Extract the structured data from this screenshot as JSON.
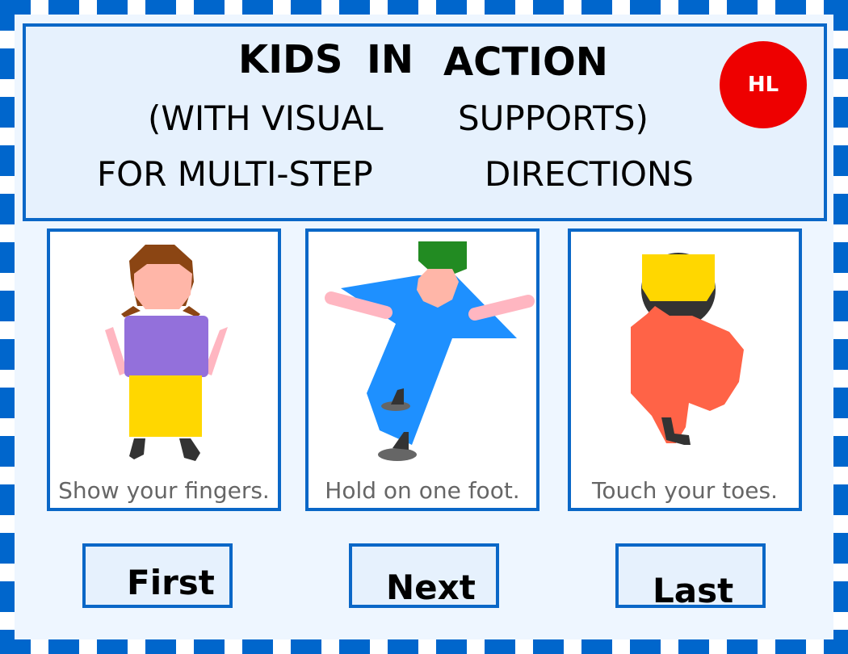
{
  "header": {
    "line1": [
      "KIDS",
      "IN",
      "ACTION"
    ],
    "line2": [
      "(WITH VISUAL",
      "SUPPORTS)"
    ],
    "line3": [
      "FOR MULTI-STEP",
      "DIRECTIONS"
    ],
    "badge": "HL"
  },
  "cards": [
    {
      "caption": "Show your fingers."
    },
    {
      "caption": "Hold on one foot."
    },
    {
      "caption": "Touch your toes."
    }
  ],
  "nav": {
    "first": "First",
    "next": "Next",
    "last": "Last"
  },
  "colors": {
    "border_blue": "#0066cc",
    "badge_red": "#ee0000",
    "caption_gray": "#666666"
  }
}
